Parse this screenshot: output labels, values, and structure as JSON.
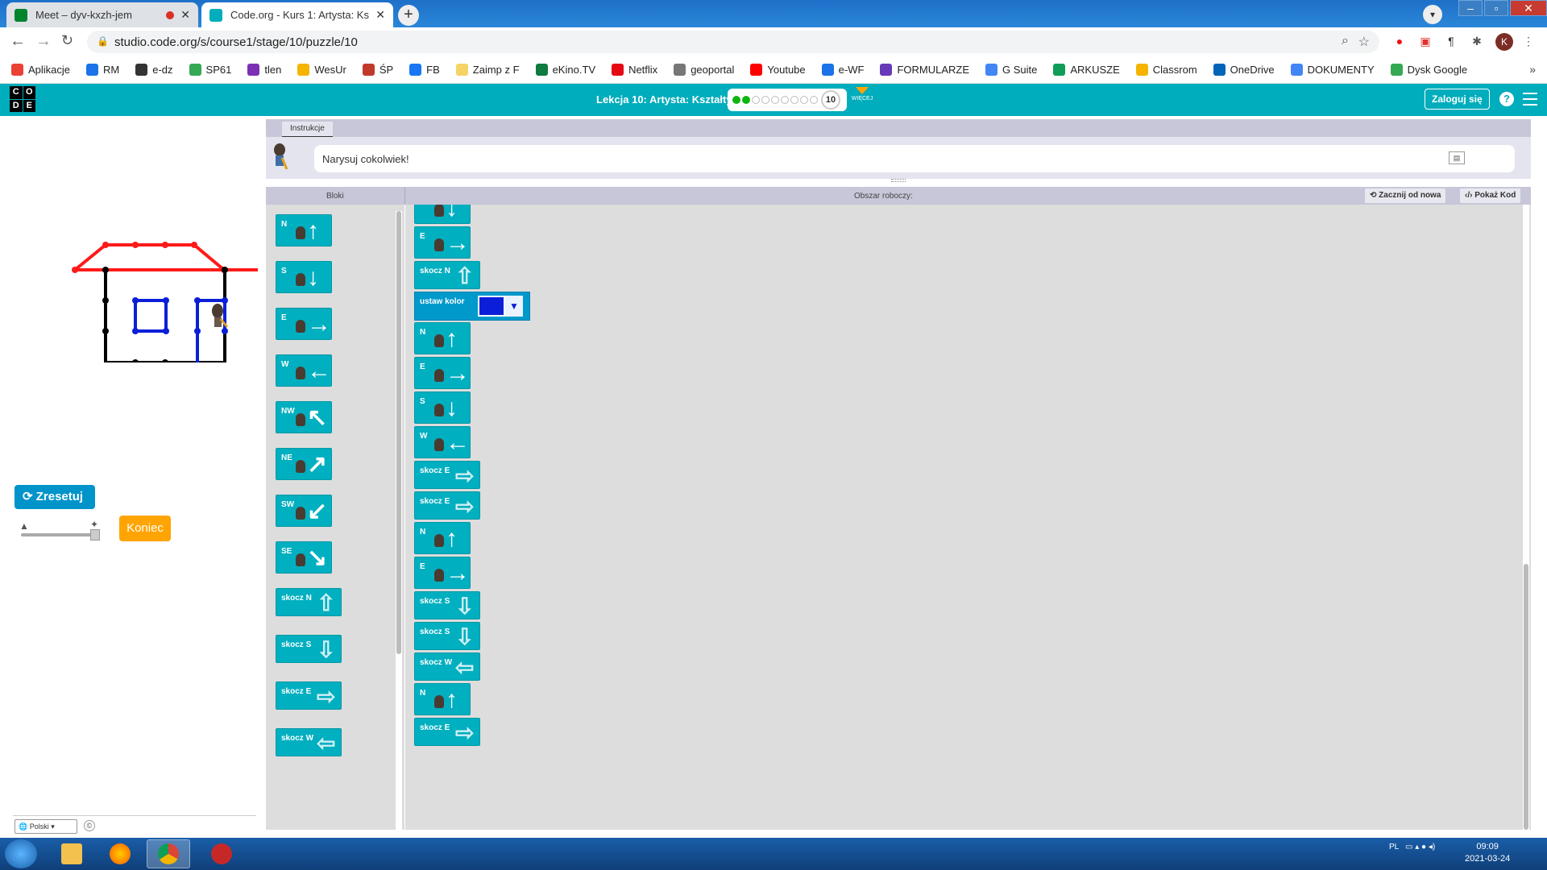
{
  "browser": {
    "tabs": [
      {
        "title": "Meet – dyv-kxzh-jem",
        "active": false
      },
      {
        "title": "Code.org - Kurs 1: Artysta: Ks",
        "active": true
      }
    ],
    "url": "studio.code.org/s/course1/stage/10/puzzle/10",
    "profile_initial": "K",
    "bookmarks": [
      {
        "label": "Aplikacje",
        "color": "#e94235"
      },
      {
        "label": "RM",
        "color": "#1a73e8"
      },
      {
        "label": "e-dz",
        "color": "#333333"
      },
      {
        "label": "SP61",
        "color": "#34a853"
      },
      {
        "label": "tlen",
        "color": "#7b2fb5"
      },
      {
        "label": "WesUr",
        "color": "#f4b400"
      },
      {
        "label": "ŚP",
        "color": "#c0392b"
      },
      {
        "label": "FB",
        "color": "#1877f2"
      },
      {
        "label": "Zaimp z F",
        "color": "#f6d365"
      },
      {
        "label": "eKino.TV",
        "color": "#0f7b3f"
      },
      {
        "label": "Netflix",
        "color": "#e50914"
      },
      {
        "label": "geoportal",
        "color": "#777777"
      },
      {
        "label": "Youtube",
        "color": "#ff0000"
      },
      {
        "label": "e-WF",
        "color": "#1a73e8"
      },
      {
        "label": "FORMULARZE",
        "color": "#673ab7"
      },
      {
        "label": "G Suite",
        "color": "#4285f4"
      },
      {
        "label": "ARKUSZE",
        "color": "#0f9d58"
      },
      {
        "label": "Classrom",
        "color": "#f4b400"
      },
      {
        "label": "OneDrive",
        "color": "#0364b8"
      },
      {
        "label": "DOKUMENTY",
        "color": "#4285f4"
      },
      {
        "label": "Dysk Google",
        "color": "#34a853"
      }
    ]
  },
  "header": {
    "logo": [
      "C",
      "O",
      "D",
      "E"
    ],
    "lesson_title": "Lekcja 10: Artysta: Kształty",
    "puzzle_number": "10",
    "more_label": "WIĘCEJ",
    "signin_label": "Zaloguj się",
    "help_label": "?"
  },
  "left": {
    "reset_label": "Zresetuj",
    "finish_label": "Koniec",
    "language": "Polski"
  },
  "instructions": {
    "tab_label": "Instrukcje",
    "text": "Narysuj cokolwiek!"
  },
  "workspace_header": {
    "blocks_label": "Bloki",
    "workspace_label": "Obszar roboczy:",
    "start_over_label": "Zacznij od nowa",
    "show_code_label": "Pokaż Kod"
  },
  "toolbox": {
    "blocks": [
      {
        "label": "N",
        "kind": "move",
        "dir": "↑"
      },
      {
        "label": "S",
        "kind": "move",
        "dir": "↓"
      },
      {
        "label": "E",
        "kind": "move",
        "dir": "→"
      },
      {
        "label": "W",
        "kind": "move",
        "dir": "←"
      },
      {
        "label": "NW",
        "kind": "move",
        "dir": "↖"
      },
      {
        "label": "NE",
        "kind": "move",
        "dir": "↗"
      },
      {
        "label": "SW",
        "kind": "move",
        "dir": "↙"
      },
      {
        "label": "SE",
        "kind": "move",
        "dir": "↘"
      },
      {
        "label": "skocz N",
        "kind": "jump",
        "dir": "⇧"
      },
      {
        "label": "skocz S",
        "kind": "jump",
        "dir": "⇩"
      },
      {
        "label": "skocz E",
        "kind": "jump",
        "dir": "⇨"
      },
      {
        "label": "skocz W",
        "kind": "jump",
        "dir": "⇦"
      }
    ]
  },
  "program": {
    "set_color_label": "ustaw kolor",
    "set_color_value": "#0b1fd8",
    "blocks": [
      {
        "label": "",
        "kind": "move",
        "dir": "↓"
      },
      {
        "label": "E",
        "kind": "move",
        "dir": "→"
      },
      {
        "label": "skocz N",
        "kind": "jump",
        "dir": "⇧"
      },
      {
        "label": "ustaw kolor",
        "kind": "color"
      },
      {
        "label": "N",
        "kind": "move",
        "dir": "↑"
      },
      {
        "label": "E",
        "kind": "move",
        "dir": "→"
      },
      {
        "label": "S",
        "kind": "move",
        "dir": "↓"
      },
      {
        "label": "W",
        "kind": "move",
        "dir": "←"
      },
      {
        "label": "skocz E",
        "kind": "jump",
        "dir": "⇨"
      },
      {
        "label": "skocz E",
        "kind": "jump",
        "dir": "⇨"
      },
      {
        "label": "N",
        "kind": "move",
        "dir": "↑"
      },
      {
        "label": "E",
        "kind": "move",
        "dir": "→"
      },
      {
        "label": "skocz S",
        "kind": "jump",
        "dir": "⇩"
      },
      {
        "label": "skocz S",
        "kind": "jump",
        "dir": "⇩"
      },
      {
        "label": "skocz W",
        "kind": "jump",
        "dir": "⇦"
      },
      {
        "label": "N",
        "kind": "move",
        "dir": "↑"
      },
      {
        "label": "skocz E",
        "kind": "jump",
        "dir": "⇨"
      }
    ]
  },
  "taskbar": {
    "lang": "PL",
    "time": "09:09",
    "date": "2021-03-24"
  },
  "colors": {
    "block": "#00afc0",
    "header": "#00adbc",
    "roof": "#ff1a1a",
    "walls": "#000000",
    "windows": "#0b1fd8"
  }
}
